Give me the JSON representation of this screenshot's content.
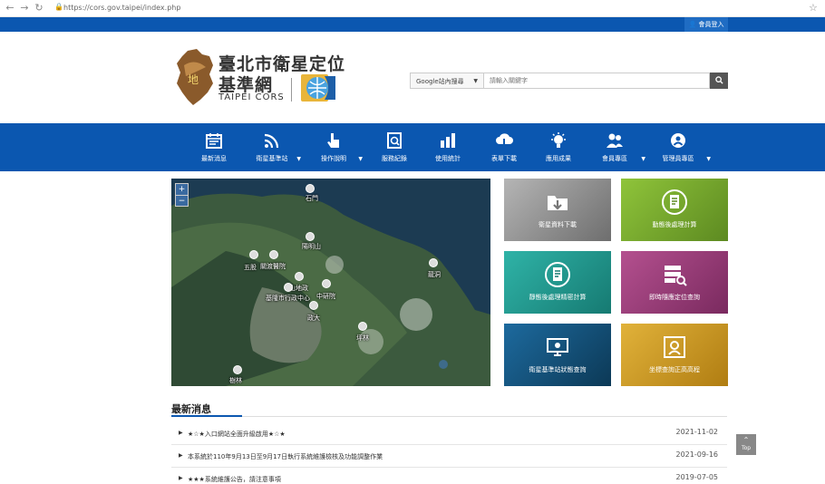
{
  "browser": {
    "url": "https://cors.gov.taipei/index.php"
  },
  "topbar": {
    "login_label": "會員登入"
  },
  "header": {
    "title_line1": "臺北市衛星定位",
    "title_line2": "基準網",
    "subtitle": "TAIPEI CORS",
    "search_scope": "Google站內搜尋",
    "search_placeholder": "請輸入關鍵字"
  },
  "nav": {
    "items": [
      {
        "label": "最新消息",
        "icon": "calendar-icon",
        "has_dropdown": false
      },
      {
        "label": "衛星基準站",
        "icon": "signal-icon",
        "has_dropdown": true
      },
      {
        "label": "操作說明",
        "icon": "hand-pointer-icon",
        "has_dropdown": true
      },
      {
        "label": "服務紀錄",
        "icon": "record-icon",
        "has_dropdown": false
      },
      {
        "label": "使用統計",
        "icon": "bar-chart-icon",
        "has_dropdown": false
      },
      {
        "label": "表單下載",
        "icon": "cloud-download-icon",
        "has_dropdown": false
      },
      {
        "label": "應用成果",
        "icon": "lightbulb-icon",
        "has_dropdown": false
      },
      {
        "label": "會員專區",
        "icon": "users-icon",
        "has_dropdown": true
      },
      {
        "label": "管理員專區",
        "icon": "admin-gear-icon",
        "has_dropdown": true
      }
    ]
  },
  "map": {
    "zoom_in": "+",
    "zoom_out": "−",
    "stations": [
      "石門",
      "陽明山",
      "五股",
      "關渡醫院",
      "山地政",
      "中研院",
      "基隆市行政中心",
      "政大",
      "坪林",
      "龍洞",
      "樹林"
    ]
  },
  "tiles": [
    {
      "label": "衛星資料下載",
      "color": "#8a8a8a",
      "icon": "folder-download-icon"
    },
    {
      "label": "動態後處理計算",
      "color": "#7dab2e",
      "icon": "document-calc-icon"
    },
    {
      "label": "靜態後處理精密計算",
      "color": "#1e9c92",
      "icon": "document-precision-icon"
    },
    {
      "label": "即時隨應定位查詢",
      "color": "#9c3a78",
      "icon": "server-search-icon"
    },
    {
      "label": "衛星基準站狀態查詢",
      "color": "#12507a",
      "icon": "monitor-status-icon"
    },
    {
      "label": "坐標查詢正高高程",
      "color": "#c8961c",
      "icon": "map-pin-icon"
    }
  ],
  "news": {
    "heading": "最新消息",
    "items": [
      {
        "text": "★☆★入口網站全面升級啟用★☆★",
        "date": "2021-11-02"
      },
      {
        "text": "本系統於110年9月13日至9月17日執行系統維護檢核及功能調整作業",
        "date": "2021-09-16"
      },
      {
        "text": "★★★系統維護公告，請注意事項",
        "date": "2019-07-05"
      }
    ]
  },
  "back_to_top": "Top"
}
